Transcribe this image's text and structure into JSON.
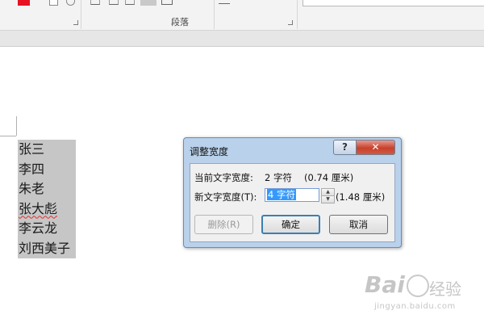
{
  "ribbon": {
    "paragraph_group_label": "段落",
    "font_color": "#e81123"
  },
  "document": {
    "names": [
      {
        "text": "张三",
        "spellcheck": false
      },
      {
        "text": "李四",
        "spellcheck": false
      },
      {
        "text": "朱老",
        "spellcheck": false
      },
      {
        "text": "张大彪",
        "spellcheck": true
      },
      {
        "text": "李云龙",
        "spellcheck": false
      },
      {
        "text": "刘西美子",
        "spellcheck": false
      }
    ],
    "selection_color": "#c6c6c6"
  },
  "dialog": {
    "title": "调整宽度",
    "help_label": "?",
    "close_label": "✕",
    "current_width_label": "当前文字宽度:",
    "current_width_value": "2 字符",
    "current_width_cm": "(0.74 厘米)",
    "new_width_label": "新文字宽度(T):",
    "new_width_value": "4 字符",
    "new_width_cm": "(1.48 厘米)",
    "spin_up": "▲",
    "spin_down": "▼",
    "delete_label": "删除(R)",
    "ok_label": "确定",
    "cancel_label": "取消"
  },
  "watermark": {
    "brand": "Bai",
    "cn": "经验",
    "url": "jingyan.baidu.com"
  }
}
